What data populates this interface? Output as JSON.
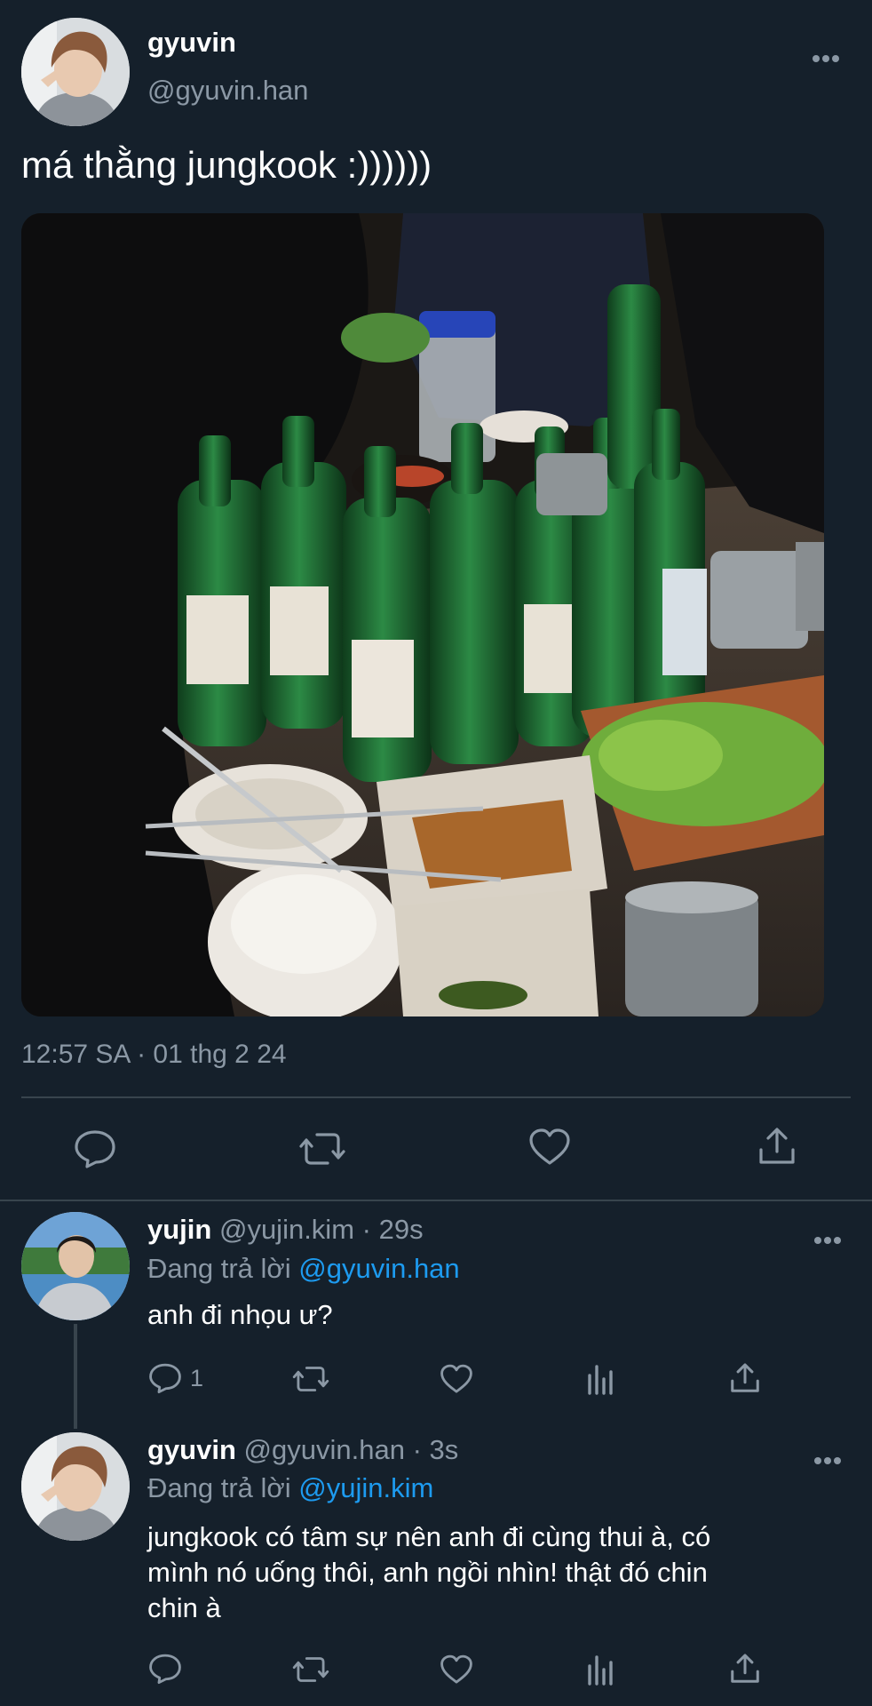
{
  "main_tweet": {
    "display_name": "gyuvin",
    "handle": "@gyuvin.han",
    "text": "má thằng jungkook :))))))",
    "timestamp": "12:57 SA · 01 thg 2 24",
    "image_caption": ""
  },
  "replies": [
    {
      "display_name": "yujin",
      "handle": "@yujin.kim",
      "time": "· 29s",
      "replying_label": "Đang trả lời",
      "replying_to": "@gyuvin.han",
      "text": "anh đi nhọu ư?",
      "reply_count": "1"
    },
    {
      "display_name": "gyuvin",
      "handle": "@gyuvin.han",
      "time": "· 3s",
      "replying_label": "Đang trả lời",
      "replying_to": "@yujin.kim",
      "text_line1": "jungkook có tâm sự nên anh đi cùng thui à, có",
      "text_line2": "mình nó uống thôi, anh ngồi nhìn! thật đó chin",
      "text_line3": "chin à",
      "reply_count": ""
    }
  ],
  "icons": {
    "more": "more-icon",
    "reply": "reply-icon",
    "retweet": "retweet-icon",
    "like": "heart-icon",
    "share": "share-icon",
    "analytics": "analytics-icon"
  },
  "colors": {
    "background": "#15202b",
    "text": "#ffffff",
    "secondary": "#8b98a5",
    "link": "#1d9bf0",
    "divider": "#38444d"
  }
}
